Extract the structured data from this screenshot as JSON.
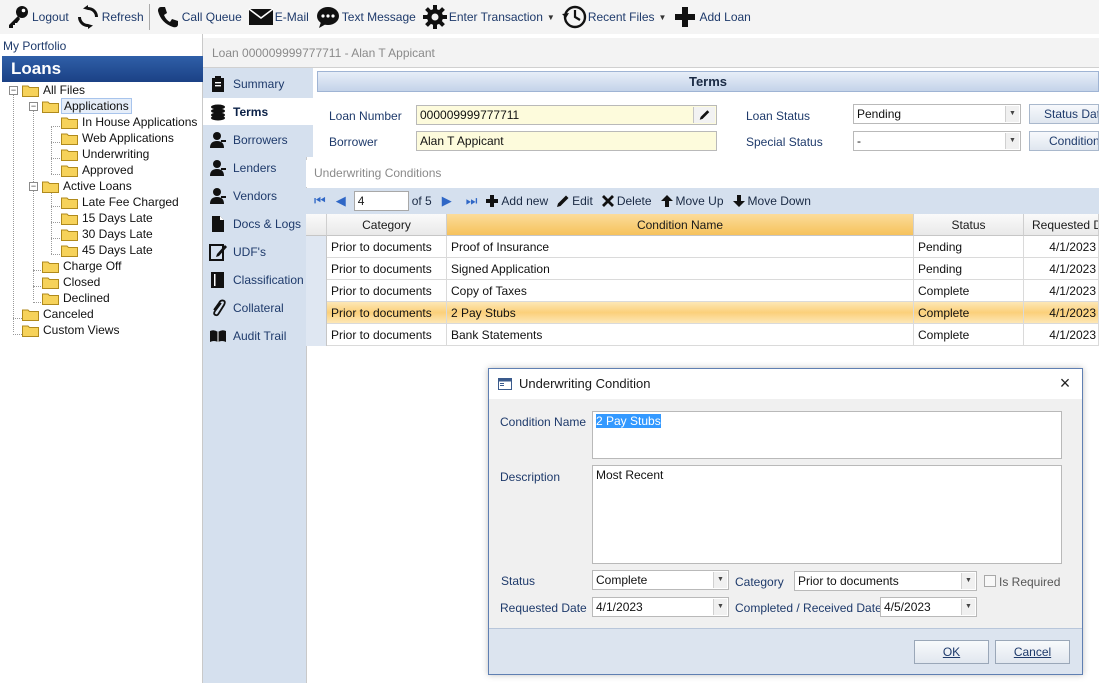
{
  "toolbar": {
    "logout": "Logout",
    "refresh": "Refresh",
    "call_queue": "Call Queue",
    "email": "E-Mail",
    "text_message": "Text Message",
    "enter_transaction": "Enter Transaction",
    "recent_files": "Recent Files",
    "add_loan": "Add Loan"
  },
  "sidebar": {
    "portfolio": "My Portfolio",
    "header": "Loans",
    "tree": {
      "all_files": "All Files",
      "applications": "Applications",
      "in_house": "In House Applications",
      "web_apps": "Web Applications",
      "underwriting": "Underwriting",
      "approved": "Approved",
      "active_loans": "Active Loans",
      "late_fee": "Late Fee Charged",
      "late15": "15 Days Late",
      "late30": "30 Days Late",
      "late45": "45 Days Late",
      "charge_off": "Charge Off",
      "closed": "Closed",
      "declined": "Declined",
      "canceled": "Canceled",
      "custom_views": "Custom Views"
    }
  },
  "nav": {
    "items": [
      "Summary",
      "Terms",
      "Borrowers",
      "Lenders",
      "Vendors",
      "Docs & Logs",
      "UDF's",
      "Classification",
      "Collateral",
      "Audit Trail"
    ],
    "icons": [
      "clipboard-icon",
      "coins-icon",
      "user-icon",
      "user-icon",
      "user-icon",
      "document-icon",
      "edit-form-icon",
      "book-icon",
      "paperclip-icon",
      "open-book-icon"
    ]
  },
  "loan": {
    "title": "Loan 000009999777711 - Alan T Appicant",
    "section": "Terms",
    "loan_number_label": "Loan Number",
    "loan_number": "000009999777711",
    "borrower_label": "Borrower",
    "borrower": "Alan T Appicant",
    "loan_status_label": "Loan Status",
    "loan_status": "Pending",
    "special_status_label": "Special Status",
    "special_status": "-",
    "status_date_btn": "Status Date",
    "conditions_btn": "Conditions"
  },
  "conditions": {
    "title": "Underwriting Conditions",
    "record": "4",
    "of_total": "of 5",
    "add_new": "Add new",
    "edit": "Edit",
    "delete": "Delete",
    "move_up": "Move Up",
    "move_down": "Move Down",
    "columns": [
      "Category",
      "Condition Name",
      "Status",
      "Requested Da"
    ],
    "rows": [
      {
        "category": "Prior to documents",
        "name": "Proof of Insurance",
        "status": "Pending",
        "date": "4/1/2023"
      },
      {
        "category": "Prior to documents",
        "name": "Signed Application",
        "status": "Pending",
        "date": "4/1/2023"
      },
      {
        "category": "Prior to documents",
        "name": "Copy of Taxes",
        "status": "Complete",
        "date": "4/1/2023"
      },
      {
        "category": "Prior to documents",
        "name": "2 Pay Stubs",
        "status": "Complete",
        "date": "4/1/2023"
      },
      {
        "category": "Prior to documents",
        "name": "Bank Statements",
        "status": "Complete",
        "date": "4/1/2023"
      }
    ],
    "selected_row": 3
  },
  "dialog": {
    "title": "Underwriting Condition",
    "condition_name_label": "Condition Name",
    "condition_name": "2 Pay Stubs",
    "description_label": "Description",
    "description": "Most Recent",
    "status_label": "Status",
    "status": "Complete",
    "category_label": "Category",
    "category": "Prior to documents",
    "is_required_label": "Is Required",
    "requested_date_label": "Requested Date",
    "requested_date": "4/1/2023",
    "completed_label": "Completed / Received Date",
    "completed_date": "4/5/2023",
    "ok": "OK",
    "cancel": "Cancel"
  }
}
